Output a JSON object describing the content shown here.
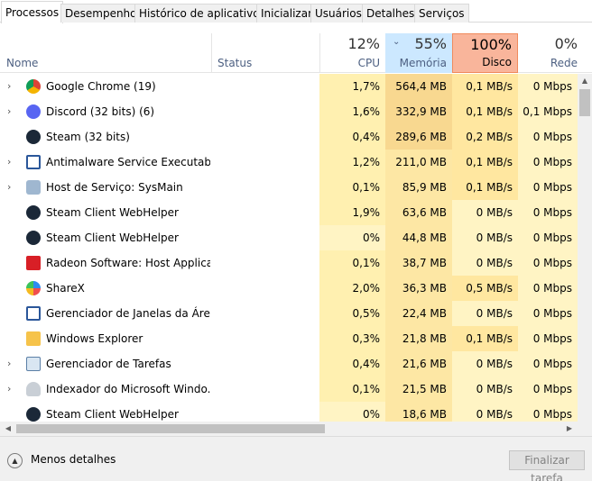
{
  "tabs": [
    {
      "label": "Processos",
      "active": true
    },
    {
      "label": "Desempenho"
    },
    {
      "label": "Histórico de aplicativos"
    },
    {
      "label": "Inicializar"
    },
    {
      "label": "Usuários"
    },
    {
      "label": "Detalhes"
    },
    {
      "label": "Serviços"
    }
  ],
  "columns": {
    "name": "Nome",
    "status": "Status",
    "cpu": {
      "percent": "12%",
      "label": "CPU"
    },
    "memory": {
      "percent": "55%",
      "label": "Memória"
    },
    "disk": {
      "percent": "100%",
      "label": "Disco"
    },
    "network": {
      "percent": "0%",
      "label": "Rede"
    }
  },
  "colors": {
    "cpu_light": "#fff4c4",
    "cpu_mid": "#fff0b0",
    "mem_dark": "#f8d890",
    "mem_mid": "#fde7a4",
    "disk_light": "#fff4c4",
    "disk_mid": "#ffe7a0",
    "net": "#fff4c4"
  },
  "processes": [
    {
      "expand": true,
      "icon": "chrome-icon",
      "name": "Google Chrome (19)",
      "cpu": "1,7%",
      "mem": "564,4 MB",
      "disk": "0,1 MB/s",
      "net": "0 Mbps"
    },
    {
      "expand": true,
      "icon": "discord-icon",
      "name": "Discord (32 bits) (6)",
      "cpu": "1,6%",
      "mem": "332,9 MB",
      "disk": "0,1 MB/s",
      "net": "0,1 Mbps"
    },
    {
      "expand": false,
      "icon": "steam-icon",
      "name": "Steam (32 bits)",
      "cpu": "0,4%",
      "mem": "289,6 MB",
      "disk": "0,2 MB/s",
      "net": "0 Mbps"
    },
    {
      "expand": true,
      "icon": "antimalware-icon",
      "name": "Antimalware Service Executable",
      "cpu": "1,2%",
      "mem": "211,0 MB",
      "disk": "0,1 MB/s",
      "net": "0 Mbps"
    },
    {
      "expand": true,
      "icon": "service-host-icon",
      "name": "Host de Serviço: SysMain",
      "cpu": "0,1%",
      "mem": "85,9 MB",
      "disk": "0,1 MB/s",
      "net": "0 Mbps"
    },
    {
      "expand": false,
      "icon": "steam-icon",
      "name": "Steam Client WebHelper",
      "cpu": "1,9%",
      "mem": "63,6 MB",
      "disk": "0 MB/s",
      "net": "0 Mbps"
    },
    {
      "expand": false,
      "icon": "steam-icon",
      "name": "Steam Client WebHelper",
      "cpu": "0%",
      "mem": "44,8 MB",
      "disk": "0 MB/s",
      "net": "0 Mbps"
    },
    {
      "expand": false,
      "icon": "radeon-icon",
      "name": "Radeon Software: Host Applicat...",
      "cpu": "0,1%",
      "mem": "38,7 MB",
      "disk": "0 MB/s",
      "net": "0 Mbps"
    },
    {
      "expand": false,
      "icon": "sharex-icon",
      "name": "ShareX",
      "cpu": "2,0%",
      "mem": "36,3 MB",
      "disk": "0,5 MB/s",
      "net": "0 Mbps"
    },
    {
      "expand": false,
      "icon": "window-manager-icon",
      "name": "Gerenciador de Janelas da Área ...",
      "cpu": "0,5%",
      "mem": "22,4 MB",
      "disk": "0 MB/s",
      "net": "0 Mbps"
    },
    {
      "expand": false,
      "icon": "folder-icon",
      "name": "Windows Explorer",
      "cpu": "0,3%",
      "mem": "21,8 MB",
      "disk": "0,1 MB/s",
      "net": "0 Mbps"
    },
    {
      "expand": true,
      "icon": "task-manager-icon",
      "name": "Gerenciador de Tarefas",
      "cpu": "0,4%",
      "mem": "21,6 MB",
      "disk": "0 MB/s",
      "net": "0 Mbps"
    },
    {
      "expand": true,
      "icon": "indexer-icon",
      "name": "Indexador do Microsoft Windo...",
      "cpu": "0,1%",
      "mem": "21,5 MB",
      "disk": "0 MB/s",
      "net": "0 Mbps"
    },
    {
      "expand": false,
      "icon": "steam-icon",
      "name": "Steam Client WebHelper",
      "cpu": "0%",
      "mem": "18,6 MB",
      "disk": "0 MB/s",
      "net": "0 Mbps"
    }
  ],
  "footer": {
    "less_details": "Menos detalhes",
    "end_task": "Finalizar tarefa"
  }
}
